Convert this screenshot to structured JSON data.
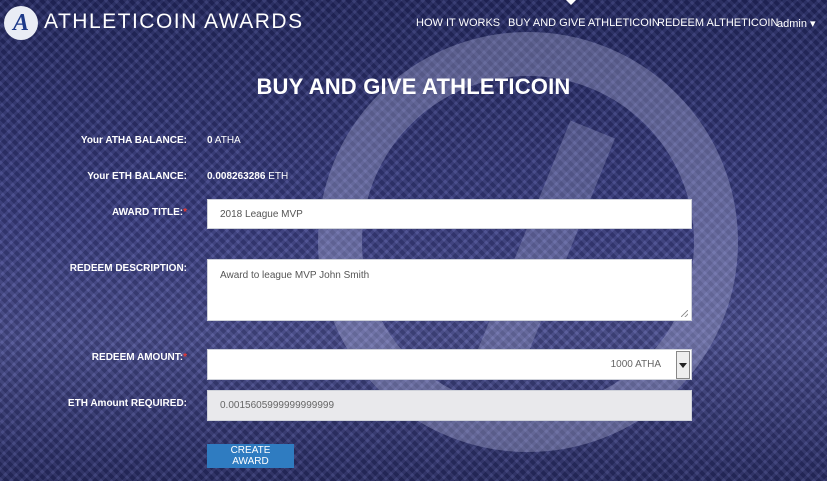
{
  "brand": "ATHLETICOIN AWARDS",
  "nav": {
    "how_it_works": "HOW IT WORKS",
    "buy_give": "BUY AND GIVE ATHLETICOIN",
    "redeem": "REDEEM ALTHETICOIN",
    "user": "admin"
  },
  "page_title": "BUY AND GIVE ATHLETICOIN",
  "form": {
    "atha_balance_label": "Your ATHA BALANCE:",
    "atha_balance_amount": "0",
    "atha_balance_unit": "ATHA",
    "eth_balance_label": "Your ETH BALANCE:",
    "eth_balance_amount": "0.008263286",
    "eth_balance_unit": "ETH",
    "award_title_label": "AWARD TITLE:",
    "award_title_value": "2018 League MVP",
    "redeem_description_label": "REDEEM DESCRIPTION:",
    "redeem_description_value": "Award to league MVP John Smith",
    "redeem_amount_label": "REDEEM AMOUNT:",
    "redeem_amount_value": "1000 ATHA",
    "eth_required_label": "ETH Amount REQUIRED:",
    "eth_required_value": "0.0015605999999999999",
    "required_marker": "*",
    "submit_label": "CREATE AWARD"
  }
}
